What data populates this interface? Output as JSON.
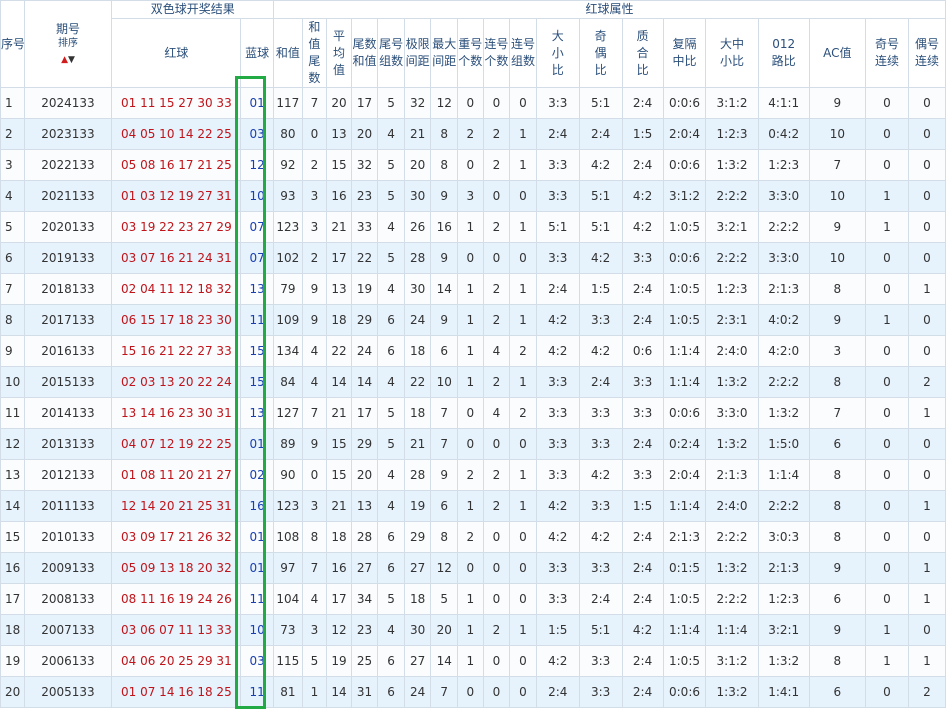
{
  "header": {
    "seq": "序号",
    "period": "期号",
    "sort": "排序",
    "group_draw": "双色球开奖结果",
    "group_attr": "红球属性",
    "red": "红球",
    "blue": "蓝球",
    "sum": "和值",
    "sum_tail": "和值尾数",
    "avg": "平均值",
    "tail_sum": "尾数和值",
    "tail_groups": "尾号组数",
    "range": "极限间距",
    "max_gap": "最大间距",
    "repeat": "重号个数",
    "consec": "连号个数",
    "consec_groups": "连号组数",
    "big_small": "大小比",
    "odd_even": "奇偶比",
    "prime": "质合比",
    "rep_gap": "复隔中比",
    "bms": "大中小比",
    "path012": "012路比",
    "ac": "AC值",
    "odd_consec": "奇号连续",
    "even_consec": "偶号连续"
  },
  "rows": [
    {
      "seq": "1",
      "period": "2024133",
      "red": "01 11 15 27 30 33",
      "blue": "01",
      "sum": "117",
      "sum_tail": "7",
      "avg": "20",
      "tail_sum": "17",
      "tail_groups": "5",
      "range": "32",
      "max_gap": "12",
      "repeat": "0",
      "consec": "0",
      "consec_groups": "0",
      "big_small": "3:3",
      "odd_even": "5:1",
      "prime": "2:4",
      "rep_gap": "0:0:6",
      "bms": "3:1:2",
      "path012": "4:1:1",
      "ac": "9",
      "odd_consec": "0",
      "even_consec": "0"
    },
    {
      "seq": "2",
      "period": "2023133",
      "red": "04 05 10 14 22 25",
      "blue": "03",
      "sum": "80",
      "sum_tail": "0",
      "avg": "13",
      "tail_sum": "20",
      "tail_groups": "4",
      "range": "21",
      "max_gap": "8",
      "repeat": "2",
      "consec": "2",
      "consec_groups": "1",
      "big_small": "2:4",
      "odd_even": "2:4",
      "prime": "1:5",
      "rep_gap": "2:0:4",
      "bms": "1:2:3",
      "path012": "0:4:2",
      "ac": "10",
      "odd_consec": "0",
      "even_consec": "0"
    },
    {
      "seq": "3",
      "period": "2022133",
      "red": "05 08 16 17 21 25",
      "blue": "12",
      "sum": "92",
      "sum_tail": "2",
      "avg": "15",
      "tail_sum": "32",
      "tail_groups": "5",
      "range": "20",
      "max_gap": "8",
      "repeat": "0",
      "consec": "2",
      "consec_groups": "1",
      "big_small": "3:3",
      "odd_even": "4:2",
      "prime": "2:4",
      "rep_gap": "0:0:6",
      "bms": "1:3:2",
      "path012": "1:2:3",
      "ac": "7",
      "odd_consec": "0",
      "even_consec": "0"
    },
    {
      "seq": "4",
      "period": "2021133",
      "red": "01 03 12 19 27 31",
      "blue": "10",
      "sum": "93",
      "sum_tail": "3",
      "avg": "16",
      "tail_sum": "23",
      "tail_groups": "5",
      "range": "30",
      "max_gap": "9",
      "repeat": "3",
      "consec": "0",
      "consec_groups": "0",
      "big_small": "3:3",
      "odd_even": "5:1",
      "prime": "4:2",
      "rep_gap": "3:1:2",
      "bms": "2:2:2",
      "path012": "3:3:0",
      "ac": "10",
      "odd_consec": "1",
      "even_consec": "0"
    },
    {
      "seq": "5",
      "period": "2020133",
      "red": "03 19 22 23 27 29",
      "blue": "07",
      "sum": "123",
      "sum_tail": "3",
      "avg": "21",
      "tail_sum": "33",
      "tail_groups": "4",
      "range": "26",
      "max_gap": "16",
      "repeat": "1",
      "consec": "2",
      "consec_groups": "1",
      "big_small": "5:1",
      "odd_even": "5:1",
      "prime": "4:2",
      "rep_gap": "1:0:5",
      "bms": "3:2:1",
      "path012": "2:2:2",
      "ac": "9",
      "odd_consec": "1",
      "even_consec": "0"
    },
    {
      "seq": "6",
      "period": "2019133",
      "red": "03 07 16 21 24 31",
      "blue": "07",
      "sum": "102",
      "sum_tail": "2",
      "avg": "17",
      "tail_sum": "22",
      "tail_groups": "5",
      "range": "28",
      "max_gap": "9",
      "repeat": "0",
      "consec": "0",
      "consec_groups": "0",
      "big_small": "3:3",
      "odd_even": "4:2",
      "prime": "3:3",
      "rep_gap": "0:0:6",
      "bms": "2:2:2",
      "path012": "3:3:0",
      "ac": "10",
      "odd_consec": "0",
      "even_consec": "0"
    },
    {
      "seq": "7",
      "period": "2018133",
      "red": "02 04 11 12 18 32",
      "blue": "13",
      "sum": "79",
      "sum_tail": "9",
      "avg": "13",
      "tail_sum": "19",
      "tail_groups": "4",
      "range": "30",
      "max_gap": "14",
      "repeat": "1",
      "consec": "2",
      "consec_groups": "1",
      "big_small": "2:4",
      "odd_even": "1:5",
      "prime": "2:4",
      "rep_gap": "1:0:5",
      "bms": "1:2:3",
      "path012": "2:1:3",
      "ac": "8",
      "odd_consec": "0",
      "even_consec": "1"
    },
    {
      "seq": "8",
      "period": "2017133",
      "red": "06 15 17 18 23 30",
      "blue": "11",
      "sum": "109",
      "sum_tail": "9",
      "avg": "18",
      "tail_sum": "29",
      "tail_groups": "6",
      "range": "24",
      "max_gap": "9",
      "repeat": "1",
      "consec": "2",
      "consec_groups": "1",
      "big_small": "4:2",
      "odd_even": "3:3",
      "prime": "2:4",
      "rep_gap": "1:0:5",
      "bms": "2:3:1",
      "path012": "4:0:2",
      "ac": "9",
      "odd_consec": "1",
      "even_consec": "0"
    },
    {
      "seq": "9",
      "period": "2016133",
      "red": "15 16 21 22 27 33",
      "blue": "15",
      "sum": "134",
      "sum_tail": "4",
      "avg": "22",
      "tail_sum": "24",
      "tail_groups": "6",
      "range": "18",
      "max_gap": "6",
      "repeat": "1",
      "consec": "4",
      "consec_groups": "2",
      "big_small": "4:2",
      "odd_even": "4:2",
      "prime": "0:6",
      "rep_gap": "1:1:4",
      "bms": "2:4:0",
      "path012": "4:2:0",
      "ac": "3",
      "odd_consec": "0",
      "even_consec": "0"
    },
    {
      "seq": "10",
      "period": "2015133",
      "red": "02 03 13 20 22 24",
      "blue": "15",
      "sum": "84",
      "sum_tail": "4",
      "avg": "14",
      "tail_sum": "14",
      "tail_groups": "4",
      "range": "22",
      "max_gap": "10",
      "repeat": "1",
      "consec": "2",
      "consec_groups": "1",
      "big_small": "3:3",
      "odd_even": "2:4",
      "prime": "3:3",
      "rep_gap": "1:1:4",
      "bms": "1:3:2",
      "path012": "2:2:2",
      "ac": "8",
      "odd_consec": "0",
      "even_consec": "2"
    },
    {
      "seq": "11",
      "period": "2014133",
      "red": "13 14 16 23 30 31",
      "blue": "13",
      "sum": "127",
      "sum_tail": "7",
      "avg": "21",
      "tail_sum": "17",
      "tail_groups": "5",
      "range": "18",
      "max_gap": "7",
      "repeat": "0",
      "consec": "4",
      "consec_groups": "2",
      "big_small": "3:3",
      "odd_even": "3:3",
      "prime": "3:3",
      "rep_gap": "0:0:6",
      "bms": "3:3:0",
      "path012": "1:3:2",
      "ac": "7",
      "odd_consec": "0",
      "even_consec": "1"
    },
    {
      "seq": "12",
      "period": "2013133",
      "red": "04 07 12 19 22 25",
      "blue": "01",
      "sum": "89",
      "sum_tail": "9",
      "avg": "15",
      "tail_sum": "29",
      "tail_groups": "5",
      "range": "21",
      "max_gap": "7",
      "repeat": "0",
      "consec": "0",
      "consec_groups": "0",
      "big_small": "3:3",
      "odd_even": "3:3",
      "prime": "2:4",
      "rep_gap": "0:2:4",
      "bms": "1:3:2",
      "path012": "1:5:0",
      "ac": "6",
      "odd_consec": "0",
      "even_consec": "0"
    },
    {
      "seq": "13",
      "period": "2012133",
      "red": "01 08 11 20 21 27",
      "blue": "02",
      "sum": "90",
      "sum_tail": "0",
      "avg": "15",
      "tail_sum": "20",
      "tail_groups": "4",
      "range": "28",
      "max_gap": "9",
      "repeat": "2",
      "consec": "2",
      "consec_groups": "1",
      "big_small": "3:3",
      "odd_even": "4:2",
      "prime": "3:3",
      "rep_gap": "2:0:4",
      "bms": "2:1:3",
      "path012": "1:1:4",
      "ac": "8",
      "odd_consec": "0",
      "even_consec": "0"
    },
    {
      "seq": "14",
      "period": "2011133",
      "red": "12 14 20 21 25 31",
      "blue": "16",
      "sum": "123",
      "sum_tail": "3",
      "avg": "21",
      "tail_sum": "13",
      "tail_groups": "4",
      "range": "19",
      "max_gap": "6",
      "repeat": "1",
      "consec": "2",
      "consec_groups": "1",
      "big_small": "4:2",
      "odd_even": "3:3",
      "prime": "1:5",
      "rep_gap": "1:1:4",
      "bms": "2:4:0",
      "path012": "2:2:2",
      "ac": "8",
      "odd_consec": "0",
      "even_consec": "1"
    },
    {
      "seq": "15",
      "period": "2010133",
      "red": "03 09 17 21 26 32",
      "blue": "01",
      "sum": "108",
      "sum_tail": "8",
      "avg": "18",
      "tail_sum": "28",
      "tail_groups": "6",
      "range": "29",
      "max_gap": "8",
      "repeat": "2",
      "consec": "0",
      "consec_groups": "0",
      "big_small": "4:2",
      "odd_even": "4:2",
      "prime": "2:4",
      "rep_gap": "2:1:3",
      "bms": "2:2:2",
      "path012": "3:0:3",
      "ac": "8",
      "odd_consec": "0",
      "even_consec": "0"
    },
    {
      "seq": "16",
      "period": "2009133",
      "red": "05 09 13 18 20 32",
      "blue": "01",
      "sum": "97",
      "sum_tail": "7",
      "avg": "16",
      "tail_sum": "27",
      "tail_groups": "6",
      "range": "27",
      "max_gap": "12",
      "repeat": "0",
      "consec": "0",
      "consec_groups": "0",
      "big_small": "3:3",
      "odd_even": "3:3",
      "prime": "2:4",
      "rep_gap": "0:1:5",
      "bms": "1:3:2",
      "path012": "2:1:3",
      "ac": "9",
      "odd_consec": "0",
      "even_consec": "1"
    },
    {
      "seq": "17",
      "period": "2008133",
      "red": "08 11 16 19 24 26",
      "blue": "11",
      "sum": "104",
      "sum_tail": "4",
      "avg": "17",
      "tail_sum": "34",
      "tail_groups": "5",
      "range": "18",
      "max_gap": "5",
      "repeat": "1",
      "consec": "0",
      "consec_groups": "0",
      "big_small": "3:3",
      "odd_even": "2:4",
      "prime": "2:4",
      "rep_gap": "1:0:5",
      "bms": "2:2:2",
      "path012": "1:2:3",
      "ac": "6",
      "odd_consec": "0",
      "even_consec": "1"
    },
    {
      "seq": "18",
      "period": "2007133",
      "red": "03 06 07 11 13 33",
      "blue": "10",
      "sum": "73",
      "sum_tail": "3",
      "avg": "12",
      "tail_sum": "23",
      "tail_groups": "4",
      "range": "30",
      "max_gap": "20",
      "repeat": "1",
      "consec": "2",
      "consec_groups": "1",
      "big_small": "1:5",
      "odd_even": "5:1",
      "prime": "4:2",
      "rep_gap": "1:1:4",
      "bms": "1:1:4",
      "path012": "3:2:1",
      "ac": "9",
      "odd_consec": "1",
      "even_consec": "0"
    },
    {
      "seq": "19",
      "period": "2006133",
      "red": "04 06 20 25 29 31",
      "blue": "03",
      "sum": "115",
      "sum_tail": "5",
      "avg": "19",
      "tail_sum": "25",
      "tail_groups": "6",
      "range": "27",
      "max_gap": "14",
      "repeat": "1",
      "consec": "0",
      "consec_groups": "0",
      "big_small": "4:2",
      "odd_even": "3:3",
      "prime": "2:4",
      "rep_gap": "1:0:5",
      "bms": "3:1:2",
      "path012": "1:3:2",
      "ac": "8",
      "odd_consec": "1",
      "even_consec": "1"
    },
    {
      "seq": "20",
      "period": "2005133",
      "red": "01 07 14 16 18 25",
      "blue": "11",
      "sum": "81",
      "sum_tail": "1",
      "avg": "14",
      "tail_sum": "31",
      "tail_groups": "6",
      "range": "24",
      "max_gap": "7",
      "repeat": "0",
      "consec": "0",
      "consec_groups": "0",
      "big_small": "2:4",
      "odd_even": "3:3",
      "prime": "2:4",
      "rep_gap": "0:0:6",
      "bms": "1:3:2",
      "path012": "1:4:1",
      "ac": "6",
      "odd_consec": "0",
      "even_consec": "2"
    }
  ],
  "colors": {
    "red_ball": "#c0141a",
    "blue_ball": "#1a3fb0",
    "highlight_border": "#22aa44",
    "row_alt": "#e6f2fc"
  }
}
